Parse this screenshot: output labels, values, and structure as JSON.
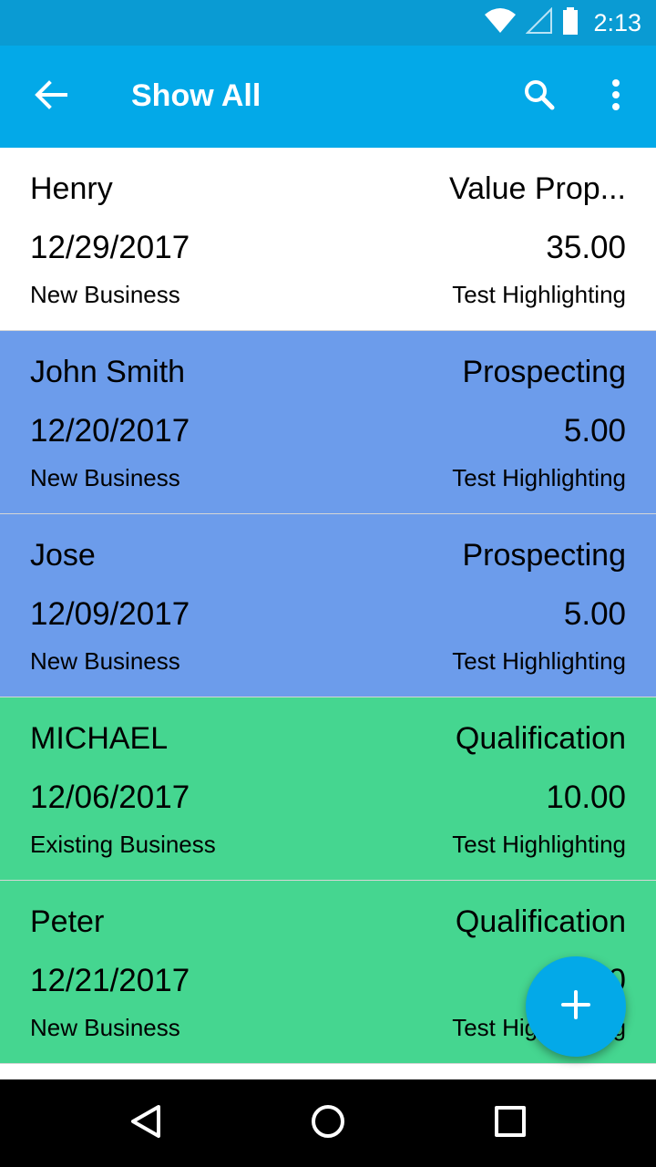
{
  "status_bar": {
    "time": "2:13",
    "icons": [
      "wifi-icon",
      "cell-signal-icon",
      "battery-icon"
    ]
  },
  "app_bar": {
    "title": "Show All",
    "icons": [
      "back-arrow-icon",
      "search-icon",
      "more-vert-icon"
    ]
  },
  "colors": {
    "status_bar": "#0a9bd3",
    "app_bar": "#03a9e8",
    "row_white": "#ffffff",
    "row_blue": "#6c9ceb",
    "row_green": "#45d690",
    "fab": "#03a9e8"
  },
  "rows": [
    {
      "name": "Henry",
      "stage": "Value Prop...",
      "date": "12/29/2017",
      "amount": "35.00",
      "type": "New Business",
      "tag": "Test Highlighting",
      "color": "#ffffff"
    },
    {
      "name": "John Smith",
      "stage": "Prospecting",
      "date": "12/20/2017",
      "amount": "5.00",
      "type": "New Business",
      "tag": "Test Highlighting",
      "color": "#6c9ceb"
    },
    {
      "name": "Jose",
      "stage": "Prospecting",
      "date": "12/09/2017",
      "amount": "5.00",
      "type": "New Business",
      "tag": "Test Highlighting",
      "color": "#6c9ceb"
    },
    {
      "name": "MICHAEL",
      "stage": "Qualification",
      "date": "12/06/2017",
      "amount": "10.00",
      "type": "Existing Business",
      "tag": "Test Highlighting",
      "color": "#45d690"
    },
    {
      "name": "Peter",
      "stage": "Qualification",
      "date": "12/21/2017",
      "amount": "5.00",
      "type": "New Business",
      "tag": "Test Highlighting",
      "color": "#45d690"
    }
  ],
  "fab": {
    "icon": "add-icon"
  },
  "nav_bar": {
    "icons": [
      "back-triangle-icon",
      "home-circle-icon",
      "recents-square-icon"
    ]
  }
}
